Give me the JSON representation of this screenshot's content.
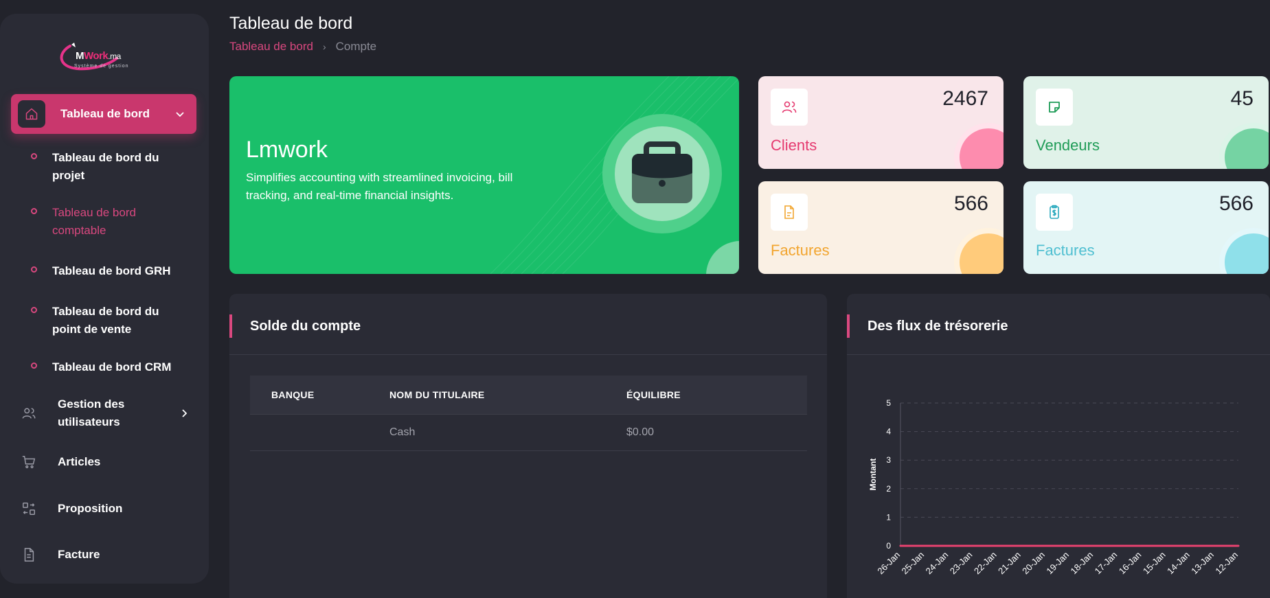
{
  "brand": {
    "logo_prefix": "M",
    "logo_highlight": "Work",
    "logo_tld": ".ma",
    "tagline": "Système de gestion"
  },
  "sidebar": {
    "active": {
      "label": "Tableau de bord"
    },
    "subitems": [
      {
        "label": "Tableau de bord du projet"
      },
      {
        "label": "Tableau de bord comptable"
      },
      {
        "label": "Tableau de bord GRH"
      },
      {
        "label": "Tableau de bord du point de vente"
      },
      {
        "label": "Tableau de bord CRM"
      }
    ],
    "items": [
      {
        "label": "Gestion des utilisateurs",
        "icon": "users-icon"
      },
      {
        "label": "Articles",
        "icon": "cart-icon"
      },
      {
        "label": "Proposition",
        "icon": "exchange-icon"
      },
      {
        "label": "Facture",
        "icon": "document-icon"
      }
    ]
  },
  "header": {
    "title": "Tableau de bord",
    "breadcrumb": {
      "root": "Tableau de bord",
      "separator": "›",
      "current": "Compte"
    }
  },
  "hero": {
    "title": "Lmwork",
    "description": "Simplifies accounting with streamlined invoicing, bill tracking, and real-time financial insights.",
    "icon": "briefcase-icon"
  },
  "stats": [
    {
      "label": "Clients",
      "value": "2467",
      "icon": "users-icon",
      "bg": "#f9e6ea",
      "accent": "#e5396f",
      "blob": "#fd8cae"
    },
    {
      "label": "Vendeurs",
      "value": "45",
      "icon": "sticky-note-icon",
      "bg": "#e0f2e9",
      "accent": "#1f9c57",
      "blob": "#75d3a3"
    },
    {
      "label": "Factures",
      "value": "566",
      "icon": "file-icon",
      "bg": "#faf0e4",
      "accent": "#f2a52f",
      "blob": "#ffcb7b"
    },
    {
      "label": "Factures",
      "value": "566",
      "icon": "clipboard-dollar-icon",
      "bg": "#e3f5f5",
      "accent": "#4fbfd1",
      "blob": "#8fe0ea"
    }
  ],
  "balance": {
    "title": "Solde du compte",
    "columns": [
      "BANQUE",
      "NOM DU TITULAIRE",
      "ÉQUILIBRE"
    ],
    "rows": [
      [
        "",
        "Cash",
        "$0.00"
      ]
    ]
  },
  "cashflow": {
    "title": "Des flux de trésorerie"
  },
  "chart_data": {
    "type": "line",
    "title": "",
    "xlabel": "",
    "ylabel": "Montant",
    "categories": [
      "26-Jan",
      "25-Jan",
      "24-Jan",
      "23-Jan",
      "22-Jan",
      "21-Jan",
      "20-Jan",
      "19-Jan",
      "18-Jan",
      "17-Jan",
      "16-Jan",
      "15-Jan",
      "14-Jan",
      "13-Jan",
      "12-Jan"
    ],
    "series": [
      {
        "values": [
          0,
          0,
          0,
          0,
          0,
          0,
          0,
          0,
          0,
          0,
          0,
          0,
          0,
          0,
          0
        ],
        "color": "#e8426f"
      }
    ],
    "ylim": [
      0,
      5
    ],
    "yticks": [
      "0",
      "1",
      "2",
      "3",
      "4",
      "5"
    ],
    "grid": true
  },
  "colors": {
    "accent": "#d9487f",
    "sidebar_bg": "#2a2b35",
    "page_bg": "#22232b",
    "hero_bg": "#1abf6a"
  }
}
